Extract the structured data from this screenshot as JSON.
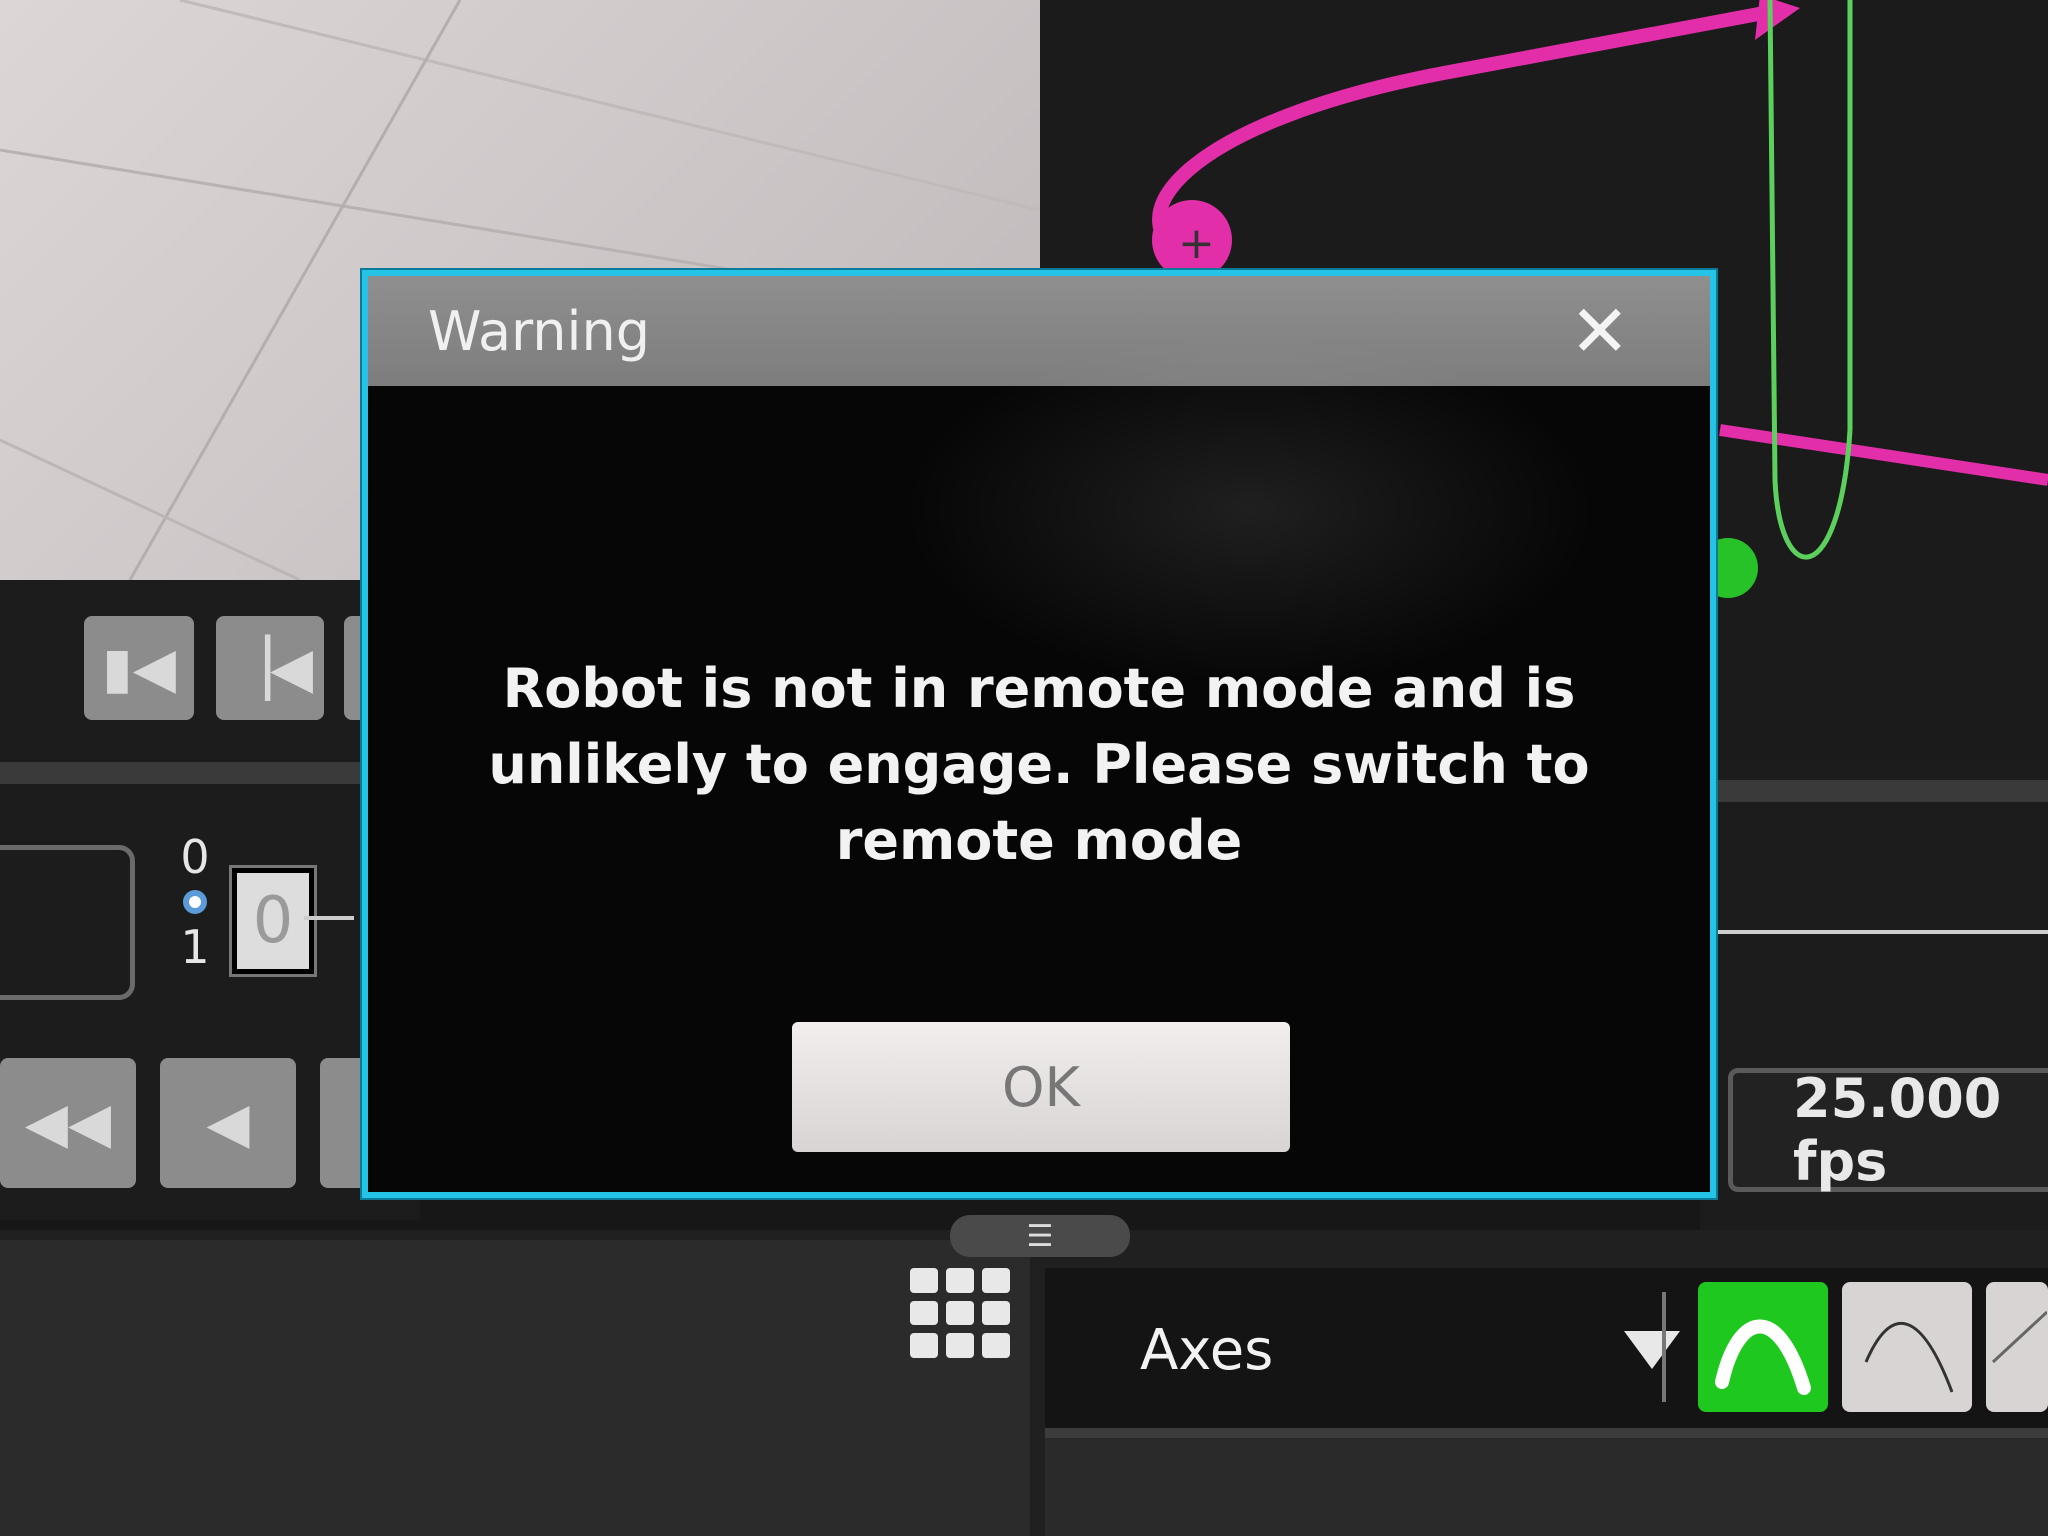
{
  "dialog": {
    "title": "Warning",
    "close_icon": "close-icon",
    "message": "Robot is not in remote mode and is unlikely to engage. Please switch to remote mode",
    "ok_label": "OK",
    "border_color": "#25c4e6"
  },
  "transport": {
    "frame_value": "0",
    "radio_top_label": "0",
    "radio_bottom_label": "1",
    "fps_label": "25.000 fps",
    "buttons": [
      {
        "icon": "skip-to-start-icon"
      },
      {
        "icon": "step-back-icon"
      },
      {
        "icon": "rewind-icon"
      },
      {
        "icon": "play-reverse-icon"
      }
    ]
  },
  "curve_editor": {
    "magenta_curve_color": "#e22ea8",
    "green_curve_color": "#5cd05c"
  },
  "toolbar": {
    "axes_label": "Axes",
    "panel_grip_icon": "panel-grip-icon",
    "grid_icon": "grid-menu-icon",
    "interpolation_buttons": [
      {
        "icon": "smooth-interpolation-icon",
        "active": true,
        "color": "#1ec81e"
      },
      {
        "icon": "ease-curve-icon",
        "active": false
      },
      {
        "icon": "linear-curve-icon",
        "active": false
      }
    ]
  }
}
